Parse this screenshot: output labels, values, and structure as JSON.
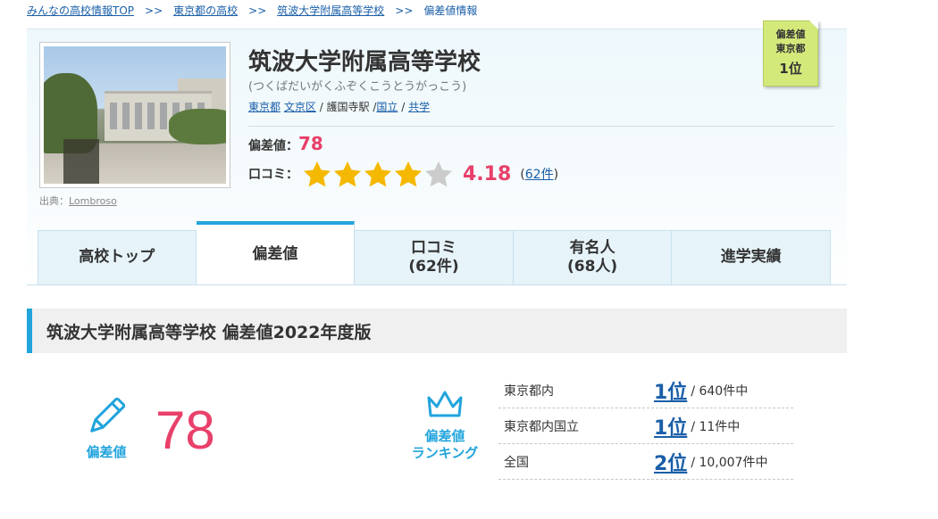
{
  "breadcrumb": {
    "items": [
      "みんなの高校情報TOP",
      "東京都の高校",
      "筑波大学附属高等学校",
      "偏差値情報"
    ],
    "separator": ">>"
  },
  "school": {
    "name": "筑波大学附属高等学校",
    "kana": "(つくばだいがくふぞくこうとうがっこう)",
    "prefecture": "東京都",
    "ward": "文京区",
    "station": "護国寺駅",
    "type": "国立",
    "gender": "共学",
    "photo_credit_label": "出典：",
    "photo_credit_name": "Lombroso"
  },
  "summary": {
    "deviation_label": "偏差値：",
    "deviation_value": "78",
    "review_label": "口コミ：",
    "rating": 4.18,
    "rating_text": "4.18",
    "review_count_text": "62件",
    "stars_max": 5
  },
  "rank_badge": {
    "line1": "偏差値",
    "line2": "東京都",
    "line3": "1位"
  },
  "tabs": [
    {
      "label": "高校トップ",
      "sub": "",
      "active": false
    },
    {
      "label": "偏差値",
      "sub": "",
      "active": true
    },
    {
      "label": "口コミ",
      "sub": "(62件)",
      "active": false
    },
    {
      "label": "有名人",
      "sub": "(68人)",
      "active": false
    },
    {
      "label": "進学実績",
      "sub": "",
      "active": false
    }
  ],
  "section": {
    "title": "筑波大学附属高等学校 偏差値2022年度版"
  },
  "deviation_block": {
    "icon_label": "偏差値",
    "value": "78"
  },
  "ranking_block": {
    "icon_label_1": "偏差値",
    "icon_label_2": "ランキング",
    "rows": [
      {
        "area": "東京都内",
        "rank": "1位",
        "total": "/ 640件中"
      },
      {
        "area": "東京都内国立",
        "rank": "1位",
        "total": "/ 11件中"
      },
      {
        "area": "全国",
        "rank": "2位",
        "total": "/ 10,007件中"
      }
    ]
  },
  "colors": {
    "accent_blue": "#21a4dc",
    "link_blue": "#1a5fa8",
    "highlight_pink": "#e8406a",
    "star_gold": "#f5b800",
    "star_gray": "#cccccc",
    "badge_green": "#d3ea7b"
  }
}
